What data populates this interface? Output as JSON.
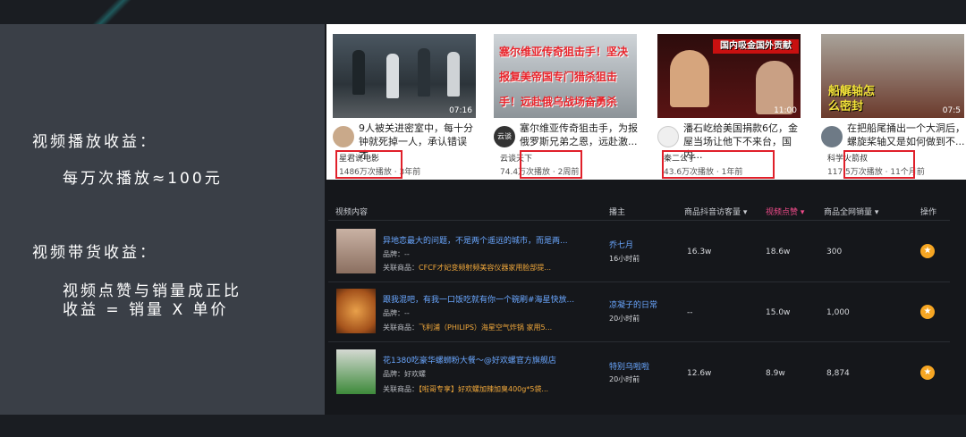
{
  "left_panel": {
    "play_revenue_title": "视频播放收益：",
    "play_revenue_formula": "每万次播放≈100元",
    "sales_revenue_title": "视频带货收益：",
    "sales_revenue_line1": "视频点赞与销量成正比",
    "sales_revenue_line2": "收益 = 销量 X 单价"
  },
  "videos": [
    {
      "title": "9人被关进密室中，每十分钟就死掉一人，承认错误才...",
      "author": "星君说电影",
      "views": "1486万次播放",
      "age": "3年前",
      "duration": "07:16",
      "overlay": ""
    },
    {
      "title": "塞尔维亚传奇狙击手，为报俄罗斯兄弟之恩，远赴激...",
      "author": "云谈天下",
      "views": "74.4万次播放",
      "age": "2周前",
      "duration": "",
      "overlay": "塞尔维亚传奇狙击手！坚决报复美帝国专门猎杀狙击手！远赴俄乌战场奋勇杀敌！"
    },
    {
      "title": "潘石屹给美国捐款6亿，金屋当场让他下不来台，国内...",
      "author": "秦二公子",
      "views": "43.6万次播放",
      "age": "1年前",
      "duration": "11:00",
      "overlay": "国内吸金国外贡献"
    },
    {
      "title": "在把船尾捅出一个大洞后，螺旋桨轴又是如何做到不...",
      "author": "科学火箭叔",
      "views": "117.5万次播放",
      "age": "11个月前",
      "duration": "07:5",
      "overlay": "船艉轴怎么密封"
    }
  ],
  "table": {
    "headers": {
      "content": "视频内容",
      "author": "播主",
      "visitors": "商品抖音访客量",
      "likes": "视频点赞",
      "sales": "商品全网销量",
      "action": "操作"
    },
    "brand_label": "品牌：",
    "product_label": "关联商品：",
    "rows": [
      {
        "title": "异地恋最大的问题，不是两个遥远的城市，而是两...",
        "brand": "--",
        "product": "CFCF才妃变频射频美容仪器家用脸部提...",
        "author": "乔七月",
        "time": "16小时前",
        "visitors": "16.3w",
        "likes": "18.6w",
        "sales": "300"
      },
      {
        "title": "跟我混吧，有我一口饭吃就有你一个碗刷#海星快放...",
        "brand": "--",
        "product": "飞利浦（PHILIPS）海星空气炸锅 家用5...",
        "author": "凉凝子的日常",
        "time": "20小时前",
        "visitors": "--",
        "likes": "15.0w",
        "sales": "1,000"
      },
      {
        "title": "花1380吃豪华螺蛳粉大餐～@好欢螺官方旗舰店",
        "brand": "好欢螺",
        "product": "【啦哥专享】好欢螺加辣加臭400g*5袋...",
        "author": "特别乌啦啦",
        "time": "20小时前",
        "visitors": "12.6w",
        "likes": "8.9w",
        "sales": "8,874"
      }
    ]
  },
  "colors": {
    "highlight_box": "#e0202a",
    "link_blue": "#6aa7ff",
    "active_sort": "#f04b8a",
    "action_orange": "#f6a623"
  }
}
